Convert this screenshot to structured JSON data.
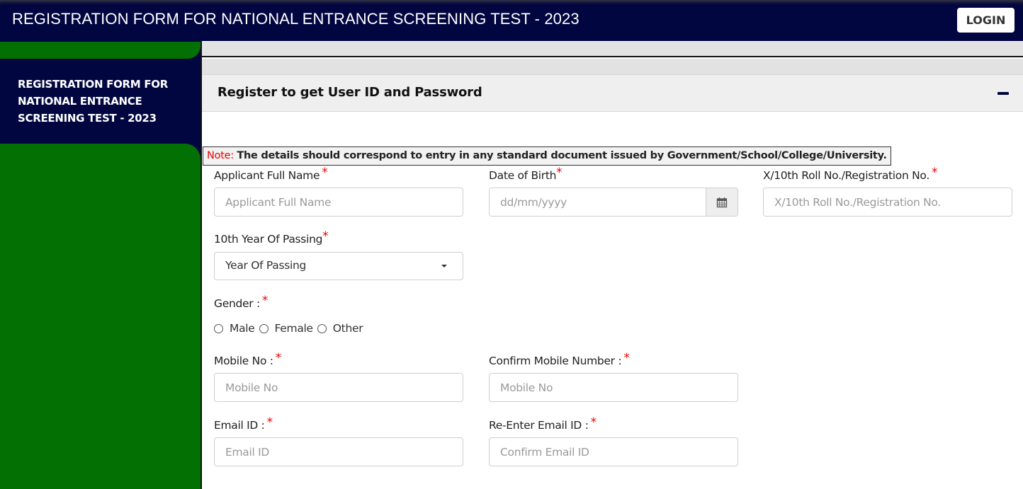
{
  "header": {
    "title": "REGISTRATION FORM FOR NATIONAL ENTRANCE SCREENING TEST - 2023",
    "login_label": "LOGIN"
  },
  "sidebar": {
    "title": "REGISTRATION FORM FOR NATIONAL ENTRANCE SCREENING TEST - 2023"
  },
  "panel": {
    "title": "Register to get User ID and Password",
    "collapse_icon": "minus-icon"
  },
  "note": {
    "label": "Note:",
    "text": "The details should correspond to entry in any standard document issued by Government/School/College/University."
  },
  "form": {
    "required_marker": "*",
    "full_name": {
      "label": "Applicant Full Name",
      "placeholder": "Applicant Full Name",
      "value": ""
    },
    "dob": {
      "label": "Date of Birth",
      "placeholder": "dd/mm/yyyy",
      "value": "",
      "icon": "calendar-icon"
    },
    "roll_no": {
      "label": "X/10th Roll No./Registration No.",
      "placeholder": "X/10th Roll No./Registration No.",
      "value": ""
    },
    "year_of_passing": {
      "label": "10th Year Of Passing",
      "selected": "Year Of Passing"
    },
    "gender": {
      "label": "Gender :",
      "options": [
        "Male",
        "Female",
        "Other"
      ],
      "selected": null
    },
    "mobile": {
      "label": "Mobile No :",
      "placeholder": "Mobile No",
      "value": ""
    },
    "confirm_mobile": {
      "label": "Confirm Mobile Number :",
      "placeholder": "Mobile No",
      "value": ""
    },
    "email": {
      "label": "Email ID :",
      "placeholder": "Email ID",
      "value": ""
    },
    "confirm_email": {
      "label": "Re-Enter Email ID :",
      "placeholder": "Confirm Email ID",
      "value": ""
    }
  },
  "colors": {
    "navy": "#020640",
    "green": "#037004",
    "required_red": "#ee0000"
  }
}
